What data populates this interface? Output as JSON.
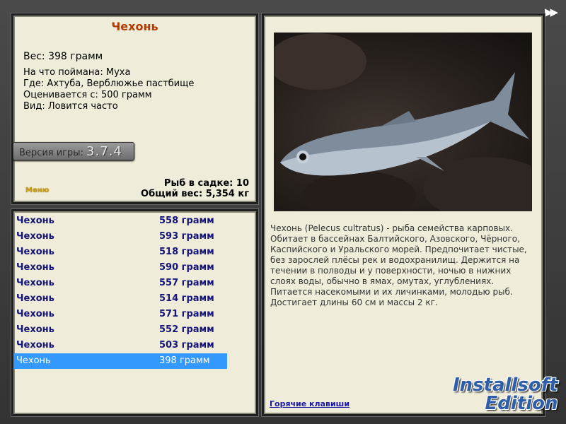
{
  "fish": {
    "name": "Чехонь",
    "weight_line": "Вес: 398 грамм",
    "caught_on": "На что поймана: Муха",
    "location": "Где: Ахтуба, Верблюжье пастбище",
    "valued_from": "Оценивается с: 500 грамм",
    "frequency": "Вид: Ловится часто"
  },
  "version": {
    "label": "Версия игры:",
    "number": "3.7.4"
  },
  "menu_link": "Меню",
  "cage": {
    "count_line": "Рыб в садке: 10",
    "total_line": "Общий вес: 5,354 кг"
  },
  "catch_list": [
    {
      "name": "Чехонь",
      "weight": "558 грамм"
    },
    {
      "name": "Чехонь",
      "weight": "593 грамм"
    },
    {
      "name": "Чехонь",
      "weight": "518 грамм"
    },
    {
      "name": "Чехонь",
      "weight": "590 грамм"
    },
    {
      "name": "Чехонь",
      "weight": "557 грамм"
    },
    {
      "name": "Чехонь",
      "weight": "514 грамм"
    },
    {
      "name": "Чехонь",
      "weight": "571 грамм"
    },
    {
      "name": "Чехонь",
      "weight": "552 грамм"
    },
    {
      "name": "Чехонь",
      "weight": "503 грамм"
    },
    {
      "name": "Чехонь",
      "weight": "398 грамм"
    }
  ],
  "description": "Чехонь (Pelecus cultratus) - рыба семейства карповых. Обитает в бассейнах Балтийского, Азовского, Чёрного, Каспийского и Уральского морей. Предпочитает чистые, без зарослей плёсы рек и водохранилищ. Держится на течении в полводы и у поверхности, ночью в нижних слоях воды, обычно в ямах, омутах, углублениях. Питается насекомыми и их личинками, молодью рыб. Достигает длины 60 см и массы 2 кг.",
  "hotkeys_link": "Горячие клавиши",
  "watermark": {
    "line1": "Installsoft",
    "line2": "Edition"
  },
  "colors": {
    "panel_bg": "#efecd9",
    "selection": "#3399ff",
    "title": "#b33a00",
    "list_text": "#16167a"
  },
  "icons": {
    "forward": "fast-forward-icon"
  }
}
